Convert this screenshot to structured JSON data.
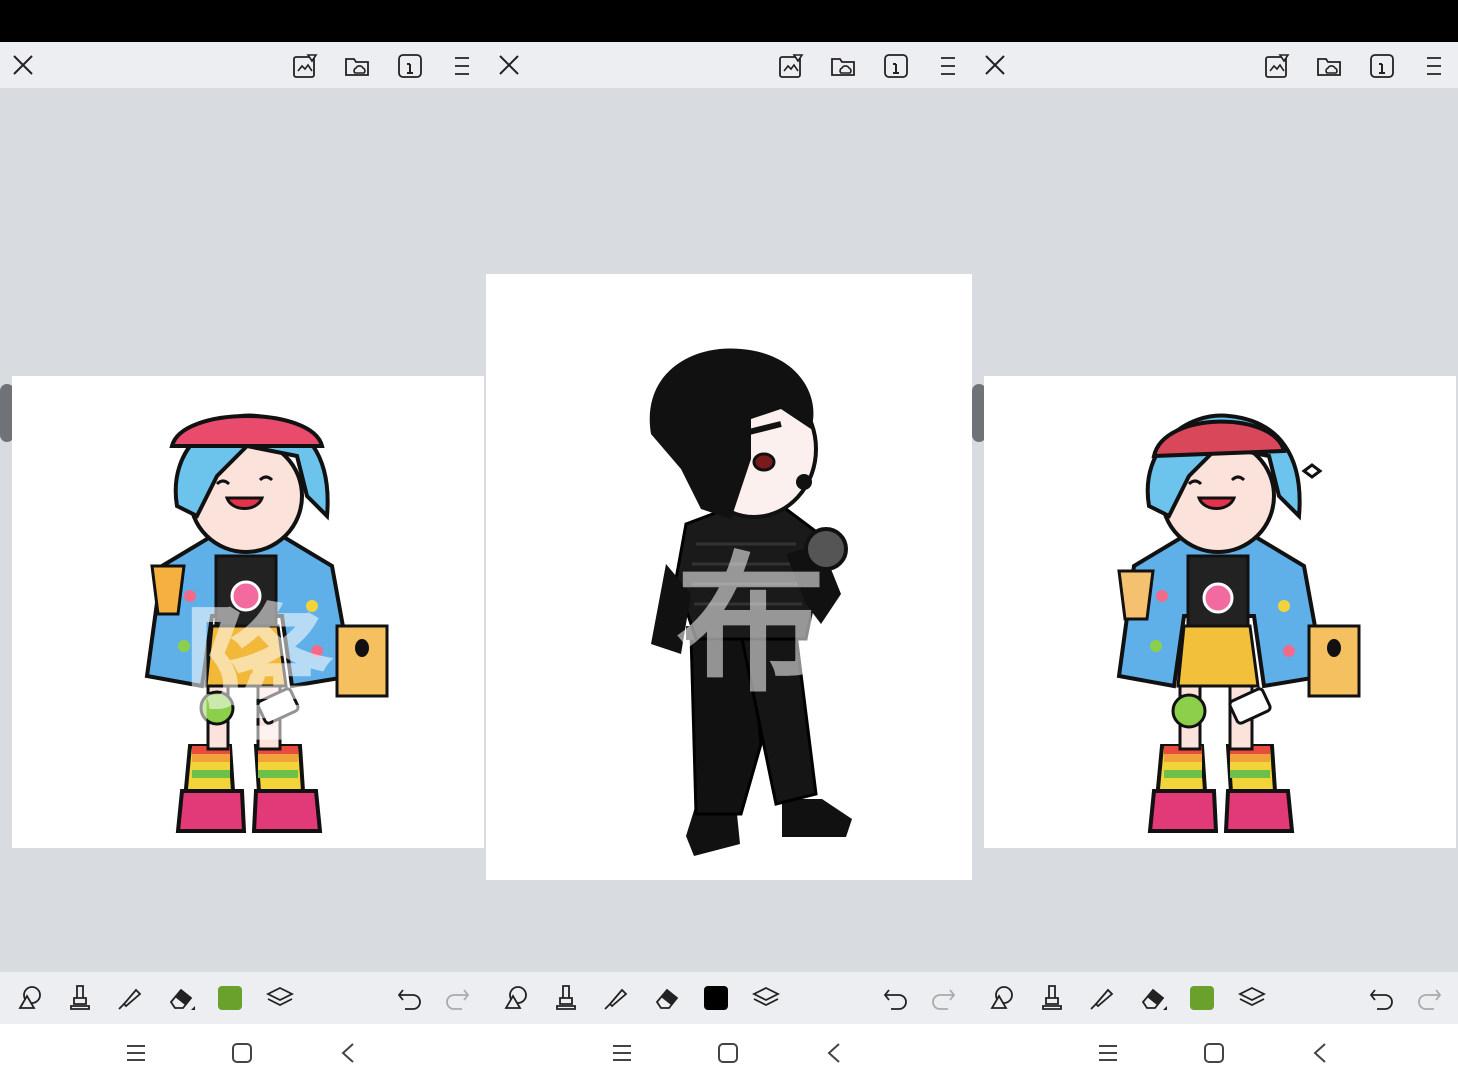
{
  "colors": {
    "toolbar_bg": "#eceef1",
    "canvas_bg": "#d8dbdf",
    "icon": "#222222",
    "swatch_green": "#6aa02c",
    "swatch_black": "#000000"
  },
  "panels": [
    {
      "toolbar_icons": [
        "close-icon",
        "gallery-icon",
        "cloud-folder-icon",
        "info-icon",
        "menu-icon"
      ],
      "active_color": "#6aa02c",
      "drawing": "colorful-character-with-blue-hair",
      "watermark": "隆"
    },
    {
      "toolbar_icons": [
        "close-icon",
        "gallery-icon",
        "cloud-folder-icon",
        "info-icon",
        "menu-icon"
      ],
      "active_color": "#000000",
      "drawing": "character-in-black-outfit",
      "watermark": "布"
    },
    {
      "toolbar_icons": [
        "close-icon",
        "gallery-icon",
        "cloud-folder-icon",
        "info-icon",
        "menu-icon"
      ],
      "active_color": "#6aa02c",
      "drawing": "colorful-character-with-beanie",
      "watermark": ""
    }
  ],
  "tools": [
    "shape-tool-icon",
    "brush-icon",
    "pen-icon",
    "eraser-icon",
    "color-swatch",
    "layers-icon",
    "undo-icon",
    "redo-icon"
  ],
  "system_nav": [
    "recent-apps-icon",
    "home-icon",
    "back-icon"
  ]
}
